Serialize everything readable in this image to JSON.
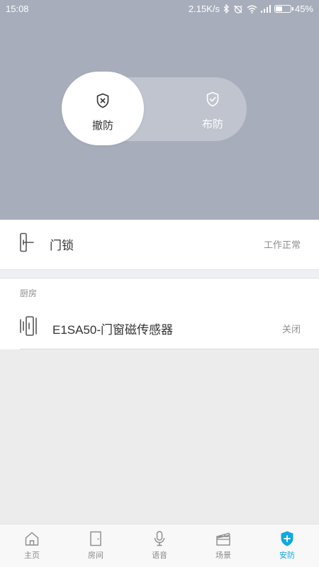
{
  "status_bar": {
    "time": "15:08",
    "network_speed": "2.15K/s",
    "battery_level": "45%",
    "icons": [
      "bluetooth-icon",
      "alarm-off-icon",
      "wifi-icon",
      "signal-icon",
      "battery-icon"
    ]
  },
  "mode_toggle": {
    "disarm_label": "撤防",
    "arm_label": "布防",
    "selected": "撤防"
  },
  "lock_card": {
    "name": "门锁",
    "status": "工作正常",
    "icon": "door-lock-icon"
  },
  "room_section": {
    "title": "厨房",
    "devices": [
      {
        "name": "E1SA50-门窗磁传感器",
        "status": "关闭",
        "icon": "door-sensor-icon"
      }
    ]
  },
  "bottom_nav": {
    "items": [
      {
        "label": "主页",
        "icon": "home-icon"
      },
      {
        "label": "房间",
        "icon": "door-icon"
      },
      {
        "label": "语音",
        "icon": "microphone-icon"
      },
      {
        "label": "场景",
        "icon": "clapperboard-icon"
      },
      {
        "label": "安防",
        "icon": "shield-plus-icon"
      }
    ],
    "active": "安防"
  },
  "colors": {
    "hero_bg": "#a7adbb",
    "active_accent": "#12a8e0",
    "page_bg": "#ececec"
  }
}
